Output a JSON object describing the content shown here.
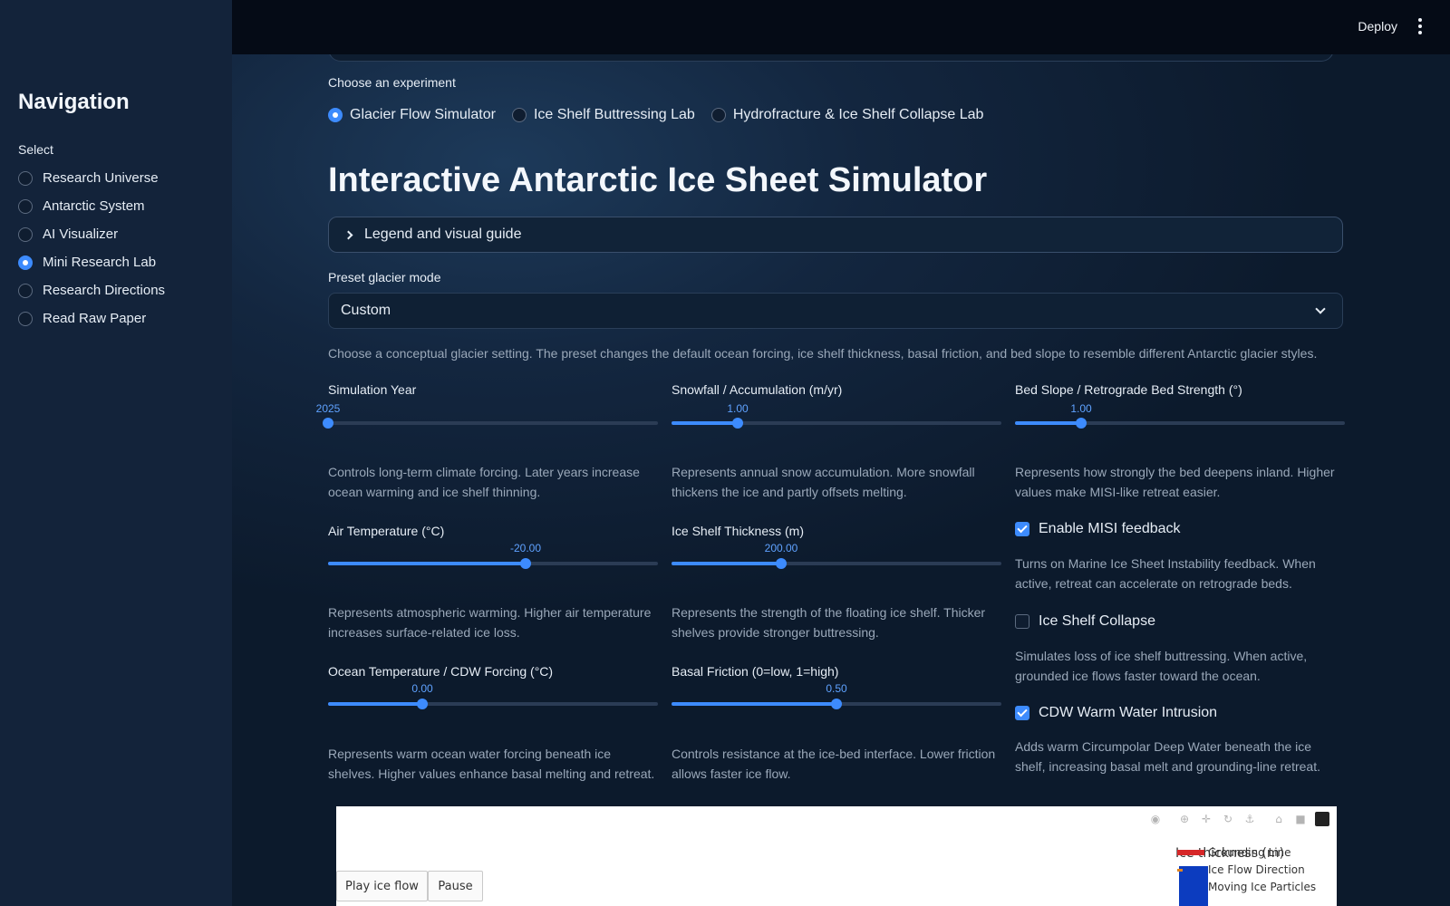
{
  "sidebar": {
    "title": "Navigation",
    "select_label": "Select",
    "items": [
      {
        "label": "Research Universe",
        "selected": false
      },
      {
        "label": "Antarctic System",
        "selected": false
      },
      {
        "label": "AI Visualizer",
        "selected": false
      },
      {
        "label": "Mini Research Lab",
        "selected": true
      },
      {
        "label": "Research Directions",
        "selected": false
      },
      {
        "label": "Read Raw Paper",
        "selected": false
      }
    ]
  },
  "header": {
    "deploy_label": "Deploy",
    "menu_icon": "kebab-menu-icon"
  },
  "experiment": {
    "label": "Choose an experiment",
    "options": [
      {
        "label": "Glacier Flow Simulator",
        "selected": true
      },
      {
        "label": "Ice Shelf Buttressing Lab",
        "selected": false
      },
      {
        "label": "Hydrofracture & Ice Shelf Collapse Lab",
        "selected": false
      }
    ]
  },
  "page_title": "Interactive Antarctic Ice Sheet Simulator",
  "expander": {
    "label": "Legend and visual guide"
  },
  "preset": {
    "label": "Preset glacier mode",
    "value": "Custom",
    "help": "Choose a conceptual glacier setting. The preset changes the default ocean forcing, ice shelf thickness, basal friction, and bed slope to resemble different Antarctic glacier styles."
  },
  "controls": {
    "simulation_year": {
      "label": "Simulation Year",
      "value": "2025",
      "fraction": 0.0,
      "help": "Controls long-term climate forcing. Later years increase ocean warming and ice shelf thinning."
    },
    "snowfall": {
      "label": "Snowfall / Accumulation (m/yr)",
      "value": "1.00",
      "fraction": 0.2,
      "help": "Represents annual snow accumulation. More snowfall thickens the ice and partly offsets melting."
    },
    "bed_slope": {
      "label": "Bed Slope / Retrograde Bed Strength (°)",
      "value": "1.00",
      "fraction": 0.2,
      "help": "Represents how strongly the bed deepens inland. Higher values make MISI-like retreat easier."
    },
    "air_temp": {
      "label": "Air Temperature (°C)",
      "value": "-20.00",
      "fraction": 0.6,
      "help": "Represents atmospheric warming. Higher air temperature increases surface-related ice loss."
    },
    "shelf_thickness": {
      "label": "Ice Shelf Thickness (m)",
      "value": "200.00",
      "fraction": 0.333,
      "help": "Represents the strength of the floating ice shelf. Thicker shelves provide stronger buttressing."
    },
    "ocean_temp": {
      "label": "Ocean Temperature / CDW Forcing (°C)",
      "value": "0.00",
      "fraction": 0.286,
      "help": "Represents warm ocean water forcing beneath ice shelves. Higher values enhance basal melting and retreat."
    },
    "basal_friction": {
      "label": "Basal Friction (0=low, 1=high)",
      "value": "0.50",
      "fraction": 0.5,
      "help": "Controls resistance at the ice-bed interface. Lower friction allows faster ice flow."
    }
  },
  "toggles": {
    "misi": {
      "label": "Enable MISI feedback",
      "checked": true,
      "help": "Turns on Marine Ice Sheet Instability feedback. When active, retreat can accelerate on retrograde beds."
    },
    "collapse": {
      "label": "Ice Shelf Collapse",
      "checked": false,
      "help": "Simulates loss of ice shelf buttressing. When active, grounded ice flows faster toward the ocean."
    },
    "cdw": {
      "label": "CDW Warm Water Intrusion",
      "checked": true,
      "help": "Adds warm Circumpolar Deep Water beneath the ice shelf, increasing basal melt and grounding-line retreat."
    }
  },
  "plot": {
    "modebar_icons": [
      "camera-icon",
      "zoom-icon",
      "pan-icon",
      "lasso-icon",
      "anchor-icon",
      "home-icon",
      "video-icon",
      "plotly-logo-icon"
    ],
    "colorbar_title": "Ice thickness (m)",
    "legend": [
      "Grounding Line",
      "Ice Flow Direction",
      "Moving Ice Particles"
    ],
    "buttons": {
      "play": "Play ice flow",
      "pause": "Pause"
    },
    "colors": {
      "grounding_line": "#d62728",
      "flow_direction": "#e0851f",
      "thickness_low": "#0c3cbf"
    }
  }
}
